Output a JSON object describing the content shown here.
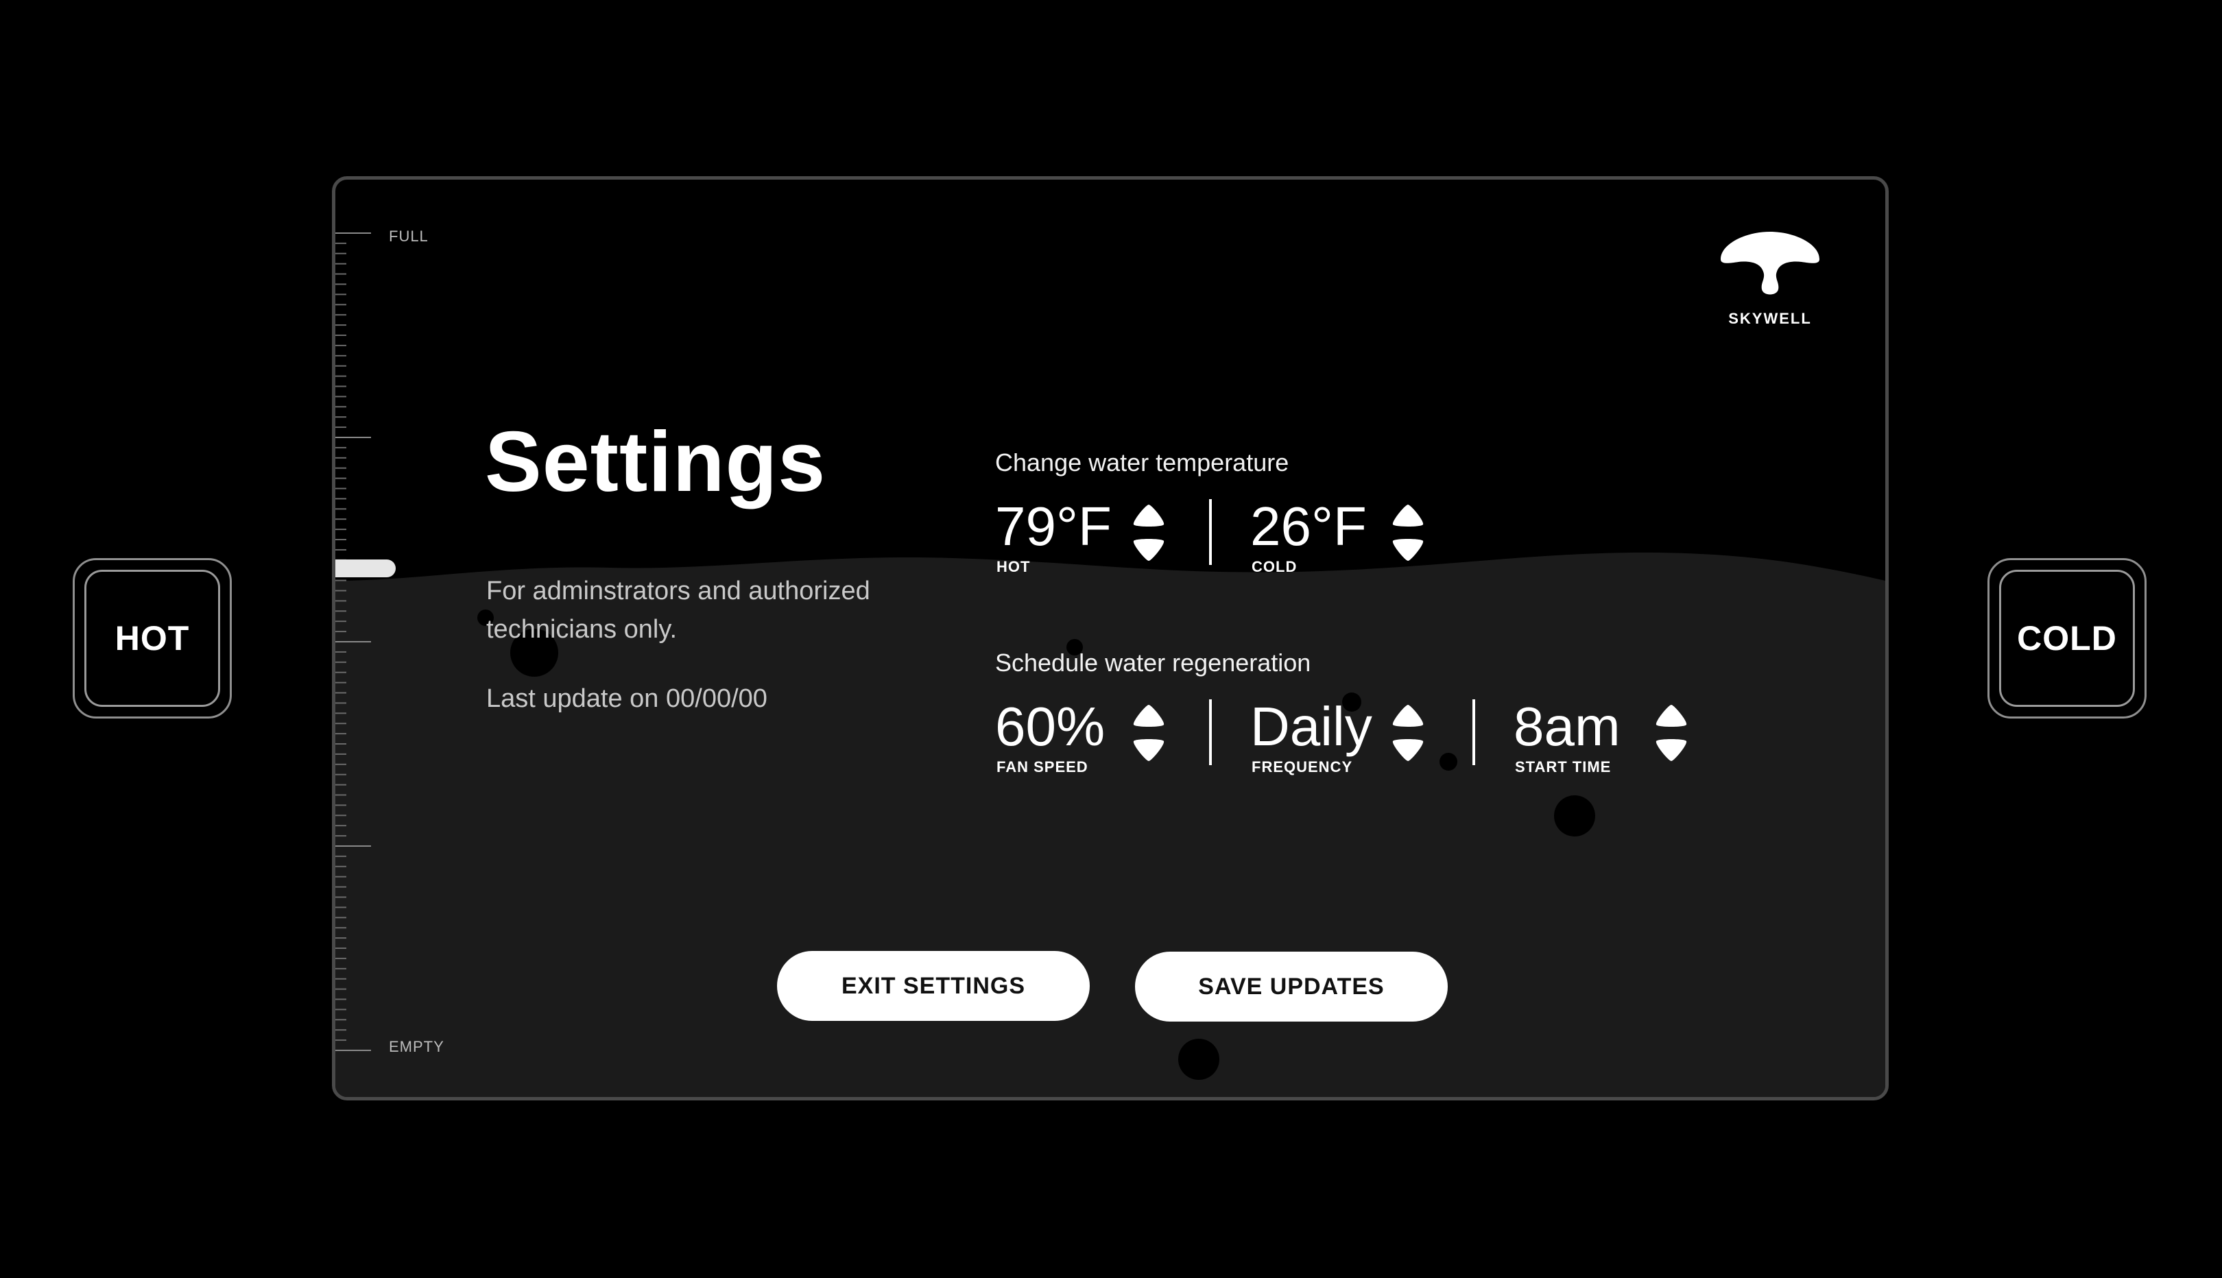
{
  "device": {
    "hot_button_label": "HOT",
    "cold_button_label": "COLD"
  },
  "gauge": {
    "full_label": "FULL",
    "empty_label": "EMPTY",
    "level_fraction": 0.59
  },
  "brand": {
    "name": "SKYWELL"
  },
  "page": {
    "title": "Settings",
    "subtitle": "For adminstrators and authorized technicians only.",
    "last_update": "Last update on 00/00/00"
  },
  "temperature": {
    "section_title": "Change water temperature",
    "hot": {
      "value": "79°F",
      "caption": "HOT"
    },
    "cold": {
      "value": "26°F",
      "caption": "COLD"
    }
  },
  "regeneration": {
    "section_title": "Schedule water regeneration",
    "fan_speed": {
      "value": "60%",
      "caption": "FAN SPEED"
    },
    "frequency": {
      "value": "Daily",
      "caption": "FREQUENCY"
    },
    "start_time": {
      "value": "8am",
      "caption": "START TIME"
    }
  },
  "actions": {
    "exit_label": "EXIT SETTINGS",
    "save_label": "SAVE UPDATES"
  },
  "colors": {
    "background": "#000000",
    "water": "#1b1b1b",
    "text": "#ffffff",
    "muted_text": "#c9c9c9",
    "button_bg": "#ffffff",
    "button_text": "#111111"
  }
}
